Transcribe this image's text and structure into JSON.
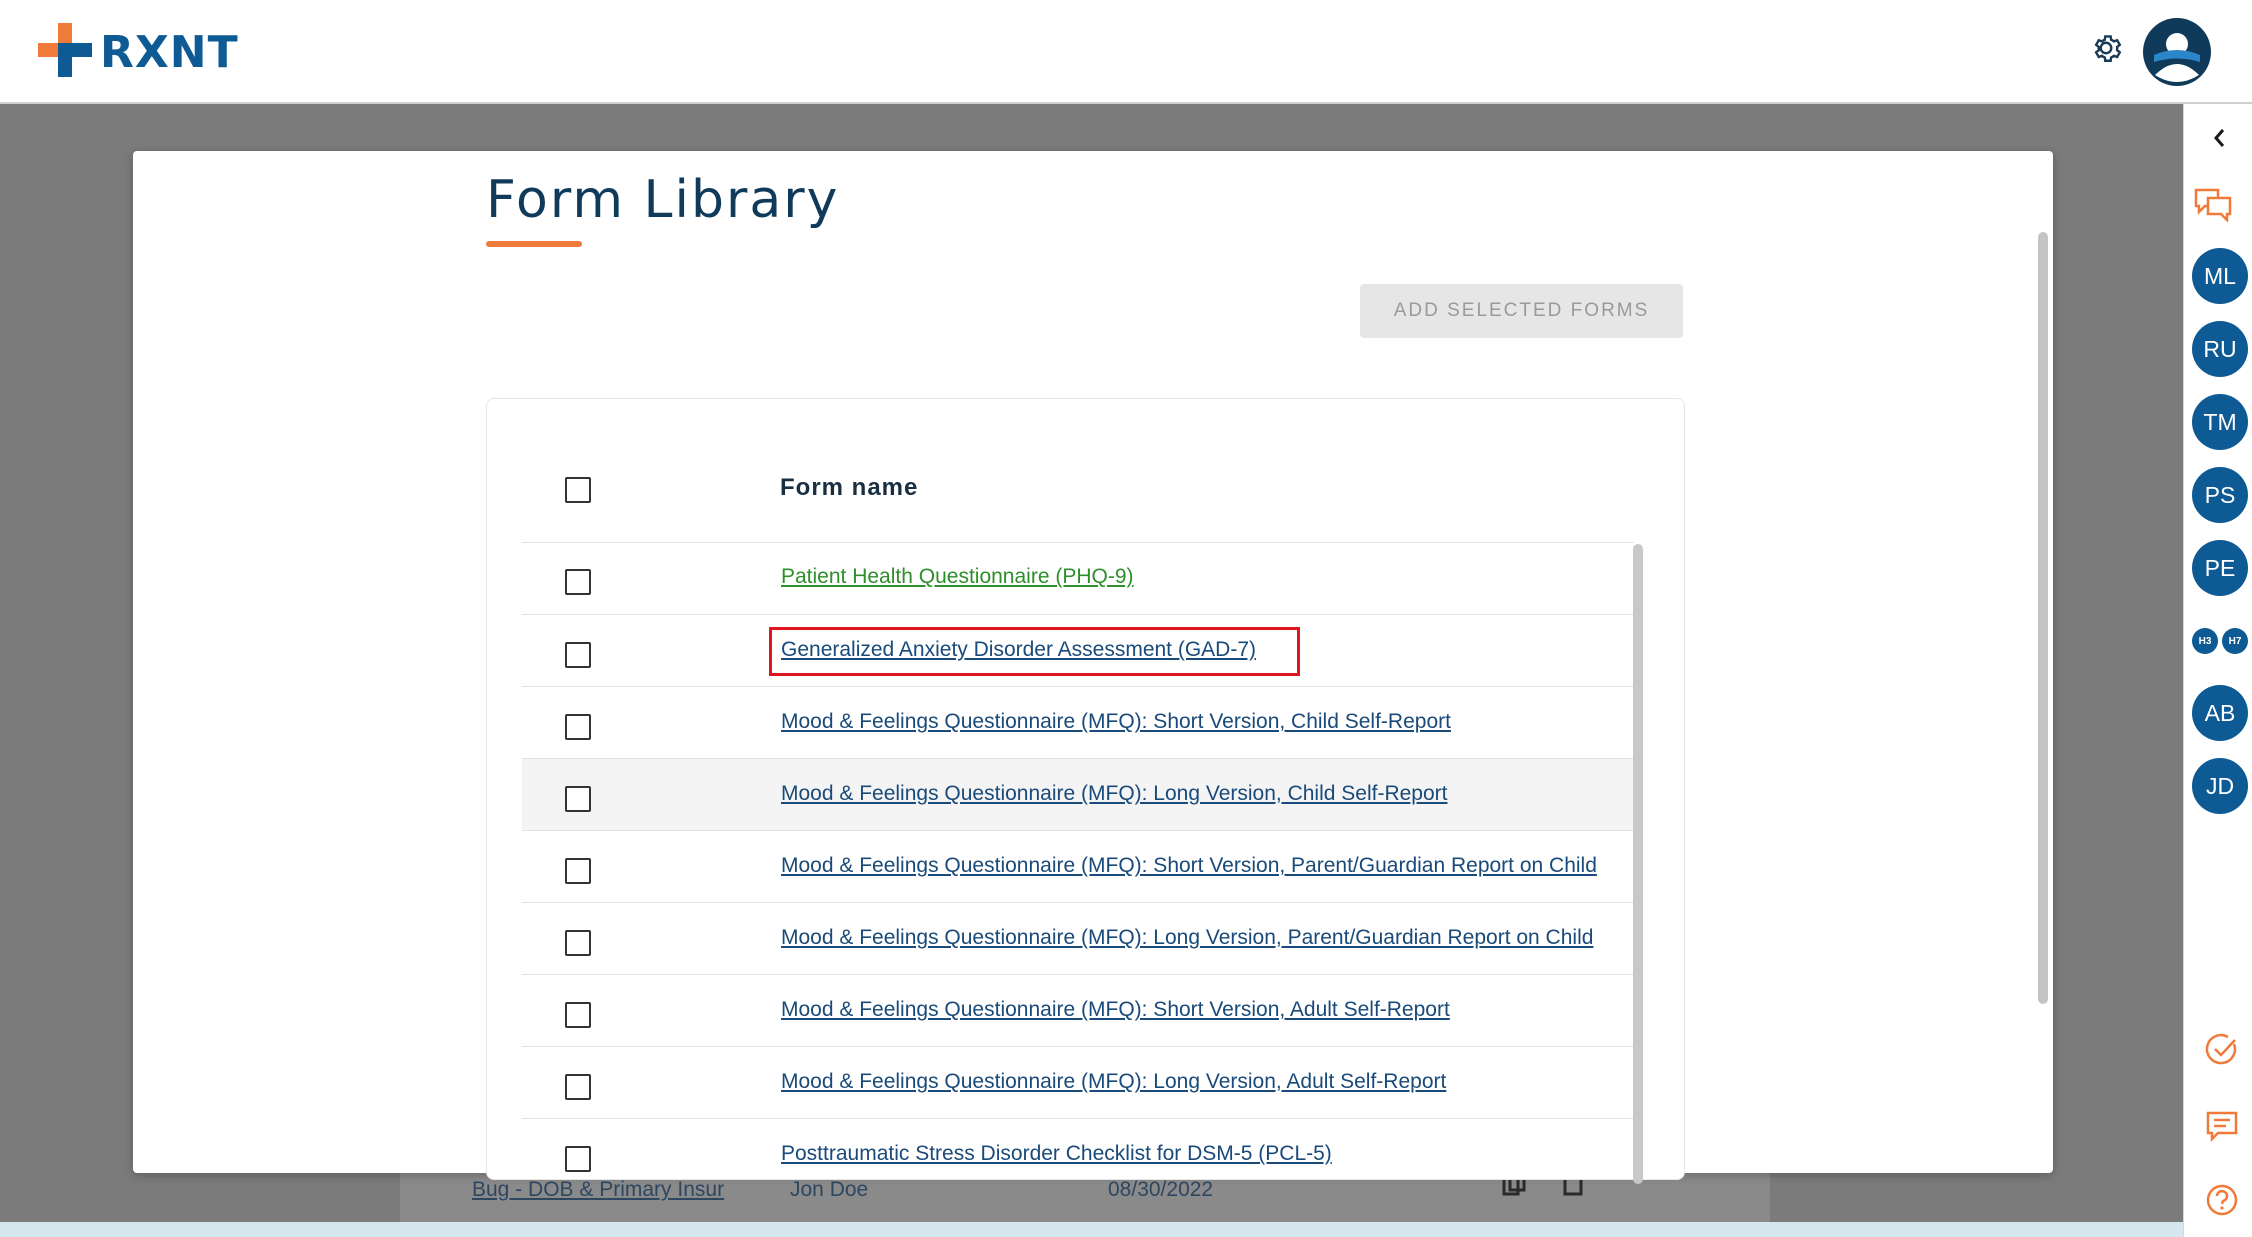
{
  "app": {
    "logo_text": "RXNT"
  },
  "header": {
    "settings_icon": "gear-icon",
    "avatar_icon": "user-avatar-icon"
  },
  "background_row": {
    "link": "Bug - DOB & Primary Insur",
    "name": "Jon Doe",
    "date": "08/30/2022"
  },
  "sidebar": {
    "collapse_icon": "chevron-left-icon",
    "chat_icon": "chat-bubbles-icon",
    "avatars": [
      "ML",
      "RU",
      "TM",
      "PS",
      "PE"
    ],
    "small_badges": [
      "H3",
      "H7"
    ],
    "avatars_lower": [
      "AB",
      "JD"
    ],
    "bottom_icons": [
      "check-circle-icon",
      "message-icon",
      "help-icon"
    ]
  },
  "modal": {
    "title": "Form Library",
    "add_button": "ADD SELECTED FORMS",
    "column_header": "Form name",
    "forms": [
      "Patient Health Questionnaire (PHQ-9)",
      "Generalized Anxiety Disorder Assessment (GAD-7)",
      "Mood & Feelings Questionnaire (MFQ): Short Version, Child Self-Report",
      "Mood & Feelings Questionnaire (MFQ): Long Version, Child Self-Report",
      "Mood & Feelings Questionnaire (MFQ): Short Version, Parent/Guardian Report on Child",
      "Mood & Feelings Questionnaire (MFQ): Long Version, Parent/Guardian Report on Child",
      "Mood & Feelings Questionnaire (MFQ): Short Version, Adult Self-Report",
      "Mood & Feelings Questionnaire (MFQ): Long Version, Adult Self-Report",
      "Posttraumatic Stress Disorder Checklist for DSM-5 (PCL-5)"
    ]
  },
  "colors": {
    "brand_blue": "#0e5a94",
    "accent_orange": "#f07a3a",
    "link_blue": "#1a4a7a",
    "visited_green": "#2f8f2a",
    "highlight_red": "#e0161f"
  }
}
